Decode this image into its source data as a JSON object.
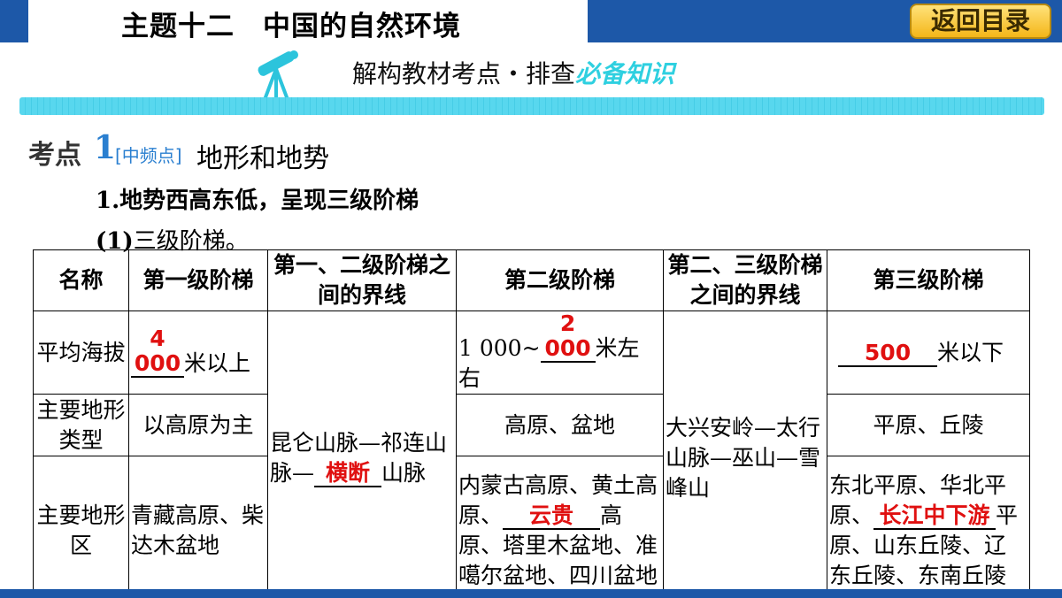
{
  "header": {
    "title": "主题十二　中国的自然环境",
    "back_button": "返回目录"
  },
  "subtitle": {
    "plain": "解构教材考点・排查",
    "emphasis": "必备知识"
  },
  "kaodian": {
    "label": "考点",
    "number": "1",
    "frequency": "[中频点]",
    "topic": "地形和地势"
  },
  "headings": {
    "h1": "1.地势西高东低，呈现三级阶梯",
    "h2_prefix": "(1)",
    "h2_text": "三级阶梯。"
  },
  "table": {
    "columns": [
      "名称",
      "第一级阶梯",
      "第一、二级阶梯之间的界线",
      "第二级阶梯",
      "第二、三级阶梯之间的界线",
      "第三级阶梯"
    ],
    "rows": {
      "elevation": {
        "label": "平均海拔",
        "first_answer": "4 000",
        "first_suffix": "米以上",
        "second_prefix": "1 000~",
        "second_answer": "2 000",
        "second_suffix": "米左右",
        "third_answer": "500",
        "third_suffix": "米以下"
      },
      "landform_type": {
        "label": "主要地形类型",
        "first": "以高原为主",
        "second": "高原、盆地",
        "third": "平原、丘陵"
      },
      "landform_region": {
        "label": "主要地形区",
        "first": "青藏高原、柴达木盆地",
        "second_prefix": "内蒙古高原、黄土高原、",
        "second_answer": "云贵",
        "second_suffix": "高原、塔里木盆地、准噶尔盆地、四川盆地",
        "third_prefix": "东北平原、华北平原、",
        "third_answer": "长江中下游",
        "third_suffix": "平原、山东丘陵、辽东丘陵、东南丘陵"
      }
    },
    "boundary1": {
      "prefix": "昆仑山脉—祁连山脉—",
      "answer": "横断",
      "suffix": "山脉"
    },
    "boundary2": "大兴安岭—太行山脉—巫山—雪峰山"
  },
  "colors": {
    "header_blue": "#1d58a8",
    "answer_red": "#e01010",
    "accent_cyan": "#2fd0e0",
    "kaodian_blue": "#2a7fd0"
  }
}
